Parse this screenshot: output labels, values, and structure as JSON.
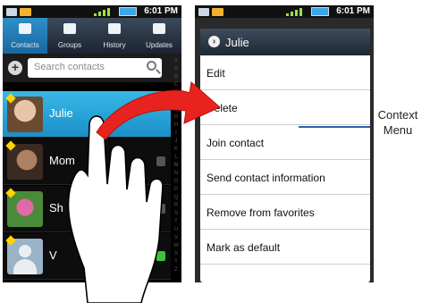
{
  "status_bar": {
    "time": "6:01 PM"
  },
  "tabs": [
    {
      "label": "Contacts",
      "icon": "contacts-icon",
      "active": true
    },
    {
      "label": "Groups",
      "icon": "groups-icon",
      "active": false
    },
    {
      "label": "History",
      "icon": "history-icon",
      "active": false
    },
    {
      "label": "Updates",
      "icon": "updates-icon",
      "active": false
    }
  ],
  "search": {
    "placeholder": "Search contacts"
  },
  "index_letters": "#ABCDEFGHIJKLMNOPQRSTUVWXYZ",
  "contacts": [
    {
      "name": "Julie",
      "highlighted": true
    },
    {
      "name": "Mom",
      "highlighted": false
    },
    {
      "name": "Sh",
      "highlighted": false
    },
    {
      "name": "V",
      "highlighted": false
    }
  ],
  "context_menu": {
    "title": "Julie",
    "items": [
      "Edit",
      "Delete",
      "Join contact",
      "Send contact information",
      "Remove from favorites",
      "Mark as default"
    ]
  },
  "annotation": {
    "line1": "Context",
    "line2": "Menu"
  },
  "colors": {
    "highlight": "#1a8fc7",
    "arrow": "#e8231f",
    "callout": "#2f5fa8"
  }
}
